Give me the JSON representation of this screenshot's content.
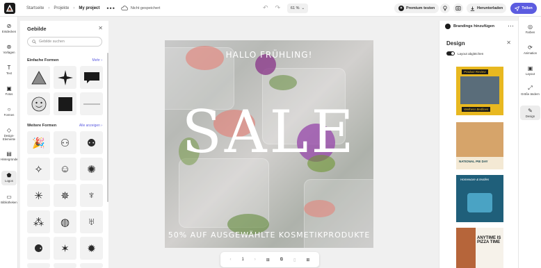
{
  "topbar": {
    "breadcrumb": [
      "Startseite",
      "Projekte",
      "My project"
    ],
    "save_status": "Nicht gespeichert",
    "zoom": "61 %",
    "premium_label": "Premium testen",
    "download_label": "Herunterladen",
    "share_label": "Teilen"
  },
  "left_rail": [
    {
      "label": "Entdecken",
      "icon": "compass-icon"
    },
    {
      "label": "Vorlagen",
      "icon": "templates-icon"
    },
    {
      "label": "Text",
      "icon": "text-icon"
    },
    {
      "label": "Fotos",
      "icon": "photos-icon"
    },
    {
      "label": "Formen",
      "icon": "shapes-icon"
    },
    {
      "label": "Design-Elemente",
      "icon": "design-elements-icon"
    },
    {
      "label": "Hintergründe",
      "icon": "backgrounds-icon"
    },
    {
      "label": "Logos",
      "icon": "logos-icon"
    },
    {
      "label": "Bibliotheken",
      "icon": "libraries-icon"
    }
  ],
  "shapes_panel": {
    "title": "Gebilde",
    "search_placeholder": "Gebilde suchen",
    "simple_title": "Einfache Formen",
    "simple_more": "Mehr",
    "more_title": "Weitere Formen",
    "more_link": "Alle anzeigen"
  },
  "canvas": {
    "headline": "HALLO FRÜHLING!",
    "sale": "SALE",
    "tagline": "50% AUF AUSGEWÄHLTE KOSMETIKPRODUKTE"
  },
  "pagebar": {
    "page": "1"
  },
  "right_panel": {
    "brand_label": "Brandings hinzufügen",
    "design_title": "Design",
    "toggle_label": "Layout abgleichen",
    "templates": [
      {
        "top": "Product Review",
        "bottom": "Wellness Bedlinen"
      },
      {
        "top": "",
        "bottom": "NATIONAL PIE DAY"
      },
      {
        "top": "Homeware & textiles",
        "bottom": ""
      },
      {
        "top": "ANYTIME IS PIZZA TIME",
        "bottom": ""
      }
    ]
  },
  "right_rail": [
    {
      "label": "Farben",
      "icon": "colors-icon"
    },
    {
      "label": "Animation",
      "icon": "animation-icon"
    },
    {
      "label": "Layout",
      "icon": "layout-icon"
    },
    {
      "label": "Größe ändern",
      "icon": "resize-icon"
    },
    {
      "label": "Design",
      "icon": "design-icon"
    }
  ],
  "colors": {
    "accent": "#5c5ce0",
    "dark": "#1a1a1a"
  }
}
